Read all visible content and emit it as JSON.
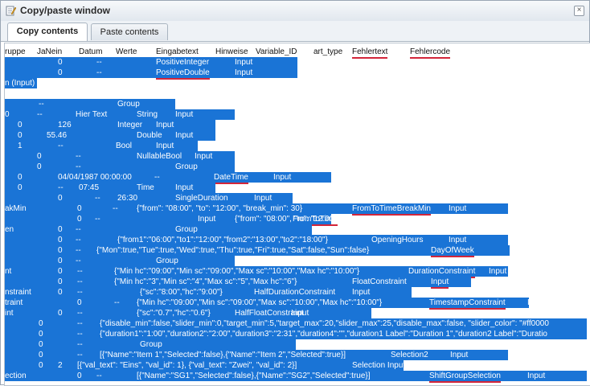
{
  "window": {
    "title": "Copy/paste window",
    "close_label": "×"
  },
  "tabs": [
    {
      "label": "Copy contents",
      "active": true
    },
    {
      "label": "Paste contents",
      "active": false
    }
  ],
  "selection_color": "#1a74d6",
  "spell_underline_color": "#d3263a",
  "rows": [
    {
      "cells": [
        "ruppe",
        "JaNein",
        "Datum",
        "Werte",
        "Eingabetext",
        "Hinweise",
        "Variable_ID",
        "art_type",
        "Fehlertext",
        "Fehlercode"
      ]
    },
    {
      "cells": [
        "0",
        "--",
        "PositiveInteger",
        "Input"
      ]
    },
    {
      "cells": [
        "0",
        "--",
        "PositiveDouble",
        "Input"
      ]
    },
    {
      "cells": [
        "n (Input)"
      ]
    },
    {
      "cells": []
    },
    {
      "cells": [
        "--",
        "Group"
      ]
    },
    {
      "cells": [
        "0",
        "--",
        "Hier Text",
        "String",
        "Input"
      ]
    },
    {
      "cells": [
        "0",
        "126",
        "Integer",
        "Input"
      ]
    },
    {
      "cells": [
        "0",
        "55.46",
        "Double",
        "Input"
      ]
    },
    {
      "cells": [
        "1",
        "--",
        "Bool",
        "Input"
      ]
    },
    {
      "cells": [
        "0",
        "--",
        "NullableBool",
        "Input"
      ]
    },
    {
      "cells": [
        "0",
        "--",
        "Group"
      ]
    },
    {
      "cells": [
        "0",
        "04/04/1987 00:00:00",
        "--",
        "DateTime",
        "Input"
      ]
    },
    {
      "cells": [
        "0",
        "--",
        "07:45",
        "Time",
        "Input"
      ]
    },
    {
      "cells": [
        "0",
        "--",
        "26:30",
        "SingleDuration",
        "Input"
      ]
    },
    {
      "cells": [
        "akMin",
        "0",
        "--",
        "{\"from\": \"08:00\", \"to\": \"12:00\", \"break_min\": 30}",
        "FromToTimeBreakMin",
        "Input"
      ]
    },
    {
      "cells": [
        "0",
        "--",
        "{\"from\": \"08:00\", \"to\": \"12:00\"}",
        "FromToTime",
        "Input"
      ]
    },
    {
      "cells": [
        "en",
        "0",
        "--",
        "Group"
      ]
    },
    {
      "cells": [
        "0",
        "--",
        "{\"from1\":\"06:00\",\"to1\":\"12:00\",\"from2\":\"13:00\",\"to2\":\"18:00\"}",
        "OpeningHours",
        "Input"
      ]
    },
    {
      "cells": [
        "0",
        "--",
        "{\"Mon\":true,\"Tue\":true,\"Wed\":true,\"Thu\":true,\"Fri\":true,\"Sat\":false,\"Sun\":false}",
        "DayOfWeek",
        "Input"
      ]
    },
    {
      "cells": [
        "0",
        "--",
        "Group"
      ]
    },
    {
      "cells": [
        "nt",
        "0",
        "--",
        "{\"Min hc\":\"09:00\",\"Min sc\":\"09:00\",\"Max sc\":\"10:00\",\"Max hc\":\"10:00\"}",
        "DurationConstraint",
        "Input"
      ]
    },
    {
      "cells": [
        "0",
        "--",
        "{\"Min hc\":\"3\",\"Min sc\":\"4\",\"Max sc\":\"5\",\"Max hc\":\"6\"}",
        "FloatConstraint",
        "Input"
      ]
    },
    {
      "cells": [
        "nstraint",
        "0",
        "--",
        "{\"sc\":\"8:00\",\"hc\":\"9:00\"}",
        "HalfDurationConstraint",
        "Input"
      ]
    },
    {
      "cells": [
        "traint",
        "0",
        "--",
        "{\"Min hc\":\"09:00\",\"Min sc\":\"09:00\",\"Max sc\":\"10:00\",\"Max hc\":\"10:00\"}",
        "TimestampConstraint",
        "Input"
      ]
    },
    {
      "cells": [
        "int",
        "0",
        "--",
        "{\"sc\":\"0.7\",\"hc\":\"0.6\"}",
        "HalfFloatConstraint",
        "Input"
      ]
    },
    {
      "cells": [
        "0",
        "--",
        "{\"disable_min\":false,\"slider_min\":0,\"target_min\":5,\"target_max\":20,\"slider_max\":25,\"disable_max\":false, \"slider_color\": \"#ff0000"
      ]
    },
    {
      "cells": [
        "0",
        "--",
        "{\"duration1\":\"1:00\",\"duration2\":\"2:00\",\"duration3\":\"2:31\",\"duration4\":\"\",\"duration1 Label\":\"Duration 1\",\"duration2 Label\":\"Duratio"
      ]
    },
    {
      "cells": [
        "0",
        "--",
        "Group"
      ]
    },
    {
      "cells": [
        "0",
        "--",
        "[{\"Name\":\"Item 1\",\"Selected\":false},{\"Name\":\"Item 2\",\"Selected\":true}]",
        "Selection2",
        "Input"
      ]
    },
    {
      "cells": [
        "0",
        "2",
        "[{\"val_text\": \"Eins\", \"val_id\": 1}, {\"val_text\": \"Zwei\", \"val_id\": 2}]",
        "Selection Input"
      ]
    },
    {
      "cells": [
        "ection",
        "0",
        "--",
        "[{\"Name\":\"SG1\",\"Selected\":false},{\"Name\":\"SG2\",\"Selected\":true}]",
        "ShiftGroupSelection",
        "Input"
      ]
    }
  ]
}
